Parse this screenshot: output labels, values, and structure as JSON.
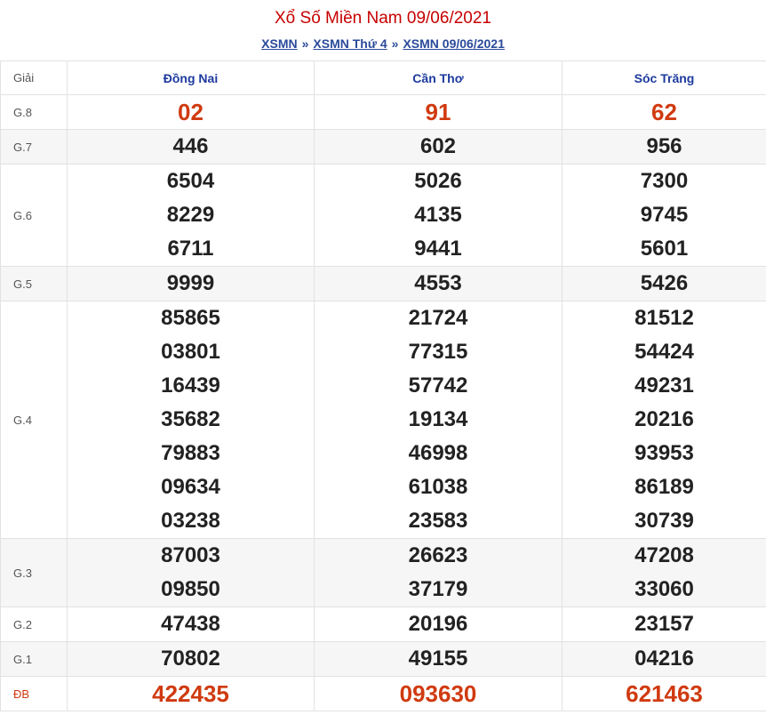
{
  "header": {
    "title": "Xổ Số Miền Nam 09/06/2021",
    "breadcrumb": [
      "XSMN",
      "XSMN Thứ 4",
      "XSMN 09/06/2021"
    ],
    "separator": "»"
  },
  "table": {
    "label_header": "Giải",
    "provinces": [
      "Đồng Nai",
      "Cần Thơ",
      "Sóc Trăng"
    ],
    "rows": [
      {
        "prize": "G.8",
        "values": [
          [
            "02"
          ],
          [
            "91"
          ],
          [
            "62"
          ]
        ]
      },
      {
        "prize": "G.7",
        "values": [
          [
            "446"
          ],
          [
            "602"
          ],
          [
            "956"
          ]
        ]
      },
      {
        "prize": "G.6",
        "values": [
          [
            "6504",
            "8229",
            "6711"
          ],
          [
            "5026",
            "4135",
            "9441"
          ],
          [
            "7300",
            "9745",
            "5601"
          ]
        ]
      },
      {
        "prize": "G.5",
        "values": [
          [
            "9999"
          ],
          [
            "4553"
          ],
          [
            "5426"
          ]
        ]
      },
      {
        "prize": "G.4",
        "values": [
          [
            "85865",
            "03801",
            "16439",
            "35682",
            "79883",
            "09634",
            "03238"
          ],
          [
            "21724",
            "77315",
            "57742",
            "19134",
            "46998",
            "61038",
            "23583"
          ],
          [
            "81512",
            "54424",
            "49231",
            "20216",
            "93953",
            "86189",
            "30739"
          ]
        ]
      },
      {
        "prize": "G.3",
        "values": [
          [
            "87003",
            "09850"
          ],
          [
            "26623",
            "37179"
          ],
          [
            "47208",
            "33060"
          ]
        ]
      },
      {
        "prize": "G.2",
        "values": [
          [
            "47438"
          ],
          [
            "20196"
          ],
          [
            "23157"
          ]
        ]
      },
      {
        "prize": "G.1",
        "values": [
          [
            "70802"
          ],
          [
            "49155"
          ],
          [
            "04216"
          ]
        ]
      },
      {
        "prize": "ĐB",
        "values": [
          [
            "422435"
          ],
          [
            "093630"
          ],
          [
            "621463"
          ]
        ]
      }
    ]
  },
  "colors": {
    "title": "#c70000",
    "link": "#2a4a9a",
    "province_header": "#1d3a9e",
    "highlight": "#d03a10",
    "number": "#222222",
    "alt_row": "#f6f6f6",
    "border": "#e2e2e2"
  }
}
